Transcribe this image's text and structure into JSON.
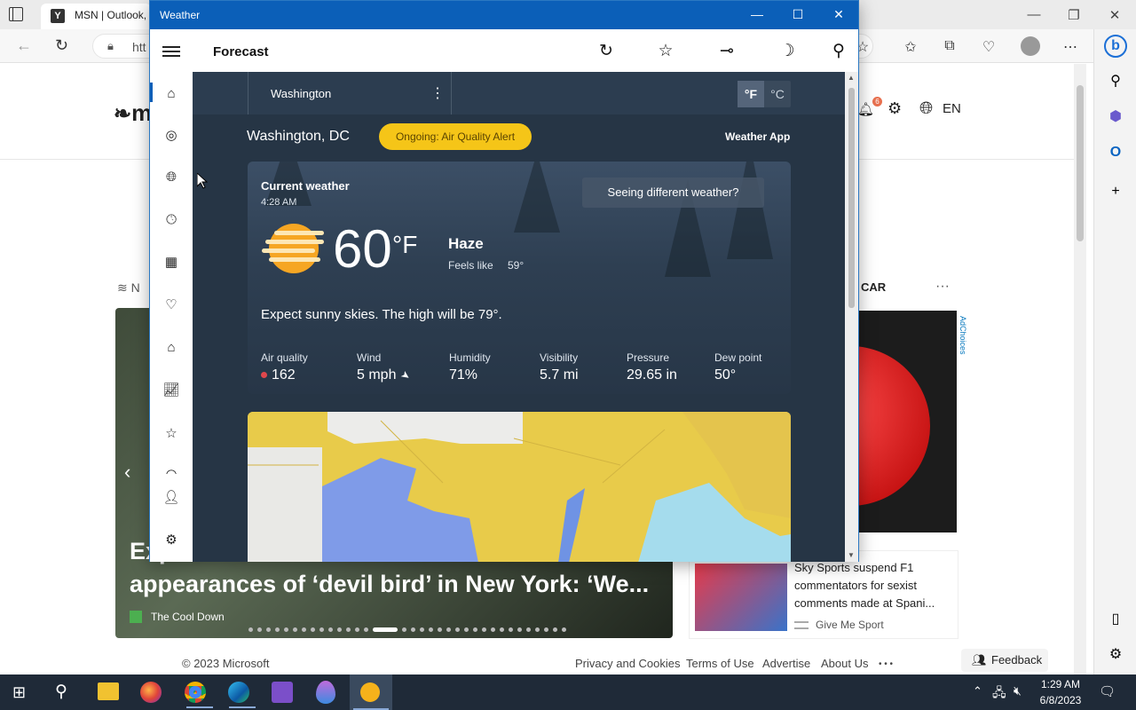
{
  "browser": {
    "tab_title": "MSN | Outlook,",
    "tab_favicon": "Y",
    "address": "htt",
    "accent": "#0b5fb8"
  },
  "msn": {
    "logo": "m",
    "language": "EN",
    "notification_count": "6",
    "section_label": "N",
    "ad_label": "CAR",
    "ad_choices": "AdChoices",
    "hero_title": "Exp... appearances of ‘devil bird’ in New York: ‘We...",
    "hero_title_line1": "Exp",
    "hero_title_line2": "appearances of ‘devil bird’ in New York: ‘We...",
    "hero_source": "The Cool Down",
    "news_title": "Sky Sports suspend F1 commentators for sexist comments made at Spani...",
    "news_source": "Give Me Sport",
    "footer": {
      "copyright": "© 2023 Microsoft",
      "privacy": "Privacy and Cookies",
      "terms": "Terms of Use",
      "advertise": "Advertise",
      "about": "About Us",
      "more": "• • •"
    },
    "feedback": "Feedback"
  },
  "weather": {
    "window_title": "Weather",
    "page_title": "Forecast",
    "location_tab": "Washington",
    "unit_f": "°F",
    "unit_c": "°C",
    "city": "Washington, DC",
    "alert": "Ongoing: Air Quality Alert",
    "weather_app_link": "Weather App",
    "current_label": "Current weather",
    "time": "4:28 AM",
    "seeing_different": "Seeing different weather?",
    "temperature": "60",
    "temp_unit": "°F",
    "condition": "Haze",
    "feels_like_label": "Feels like",
    "feels_like_value": "59°",
    "summary": "Expect sunny skies. The high will be 79°.",
    "metrics": [
      {
        "label": "Air quality",
        "value": "162"
      },
      {
        "label": "Wind",
        "value": "5 mph"
      },
      {
        "label": "Humidity",
        "value": "71%"
      },
      {
        "label": "Visibility",
        "value": "5.7 mi"
      },
      {
        "label": "Pressure",
        "value": "29.65 in"
      },
      {
        "label": "Dew point",
        "value": "50°"
      }
    ],
    "alert_color": "#f5c518"
  },
  "taskbar": {
    "time": "1:29 AM",
    "date": "6/8/2023"
  }
}
